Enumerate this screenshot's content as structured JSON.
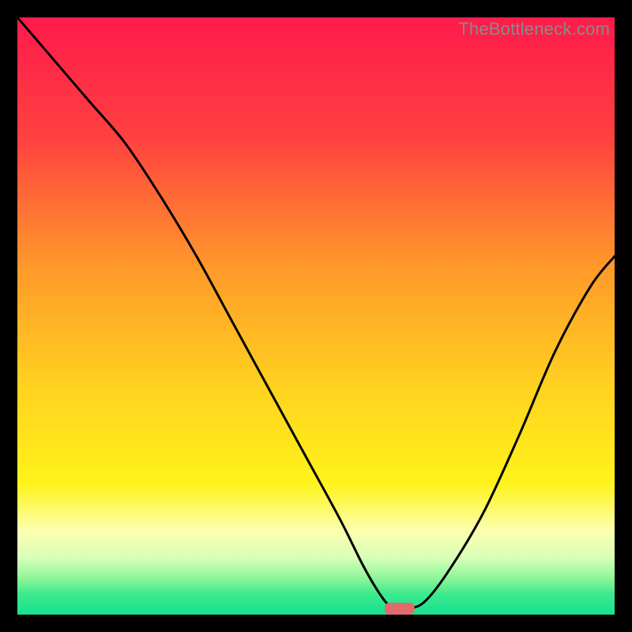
{
  "watermark": "TheBottleneck.com",
  "chart_data": {
    "type": "line",
    "title": "",
    "xlabel": "",
    "ylabel": "",
    "xlim": [
      0,
      100
    ],
    "ylim": [
      0,
      100
    ],
    "grid": false,
    "legend": false,
    "background_gradient_stops": [
      {
        "offset": 0.0,
        "color": "#ff1a4b"
      },
      {
        "offset": 0.2,
        "color": "#ff4040"
      },
      {
        "offset": 0.42,
        "color": "#ff9a2a"
      },
      {
        "offset": 0.62,
        "color": "#ffd21f"
      },
      {
        "offset": 0.78,
        "color": "#fff31a"
      },
      {
        "offset": 0.86,
        "color": "#fcffb0"
      },
      {
        "offset": 0.905,
        "color": "#d7ffb8"
      },
      {
        "offset": 0.94,
        "color": "#8cf598"
      },
      {
        "offset": 0.965,
        "color": "#3dea8d"
      },
      {
        "offset": 1.0,
        "color": "#16e18f"
      }
    ],
    "series": [
      {
        "name": "bottleneck-curve",
        "color": "#000000",
        "x": [
          0,
          6,
          12,
          18,
          24,
          30,
          36,
          42,
          48,
          54,
          58,
          61,
          63,
          65,
          68,
          72,
          78,
          84,
          90,
          96,
          100
        ],
        "values": [
          100,
          93,
          86,
          79,
          70,
          60,
          49,
          38,
          27,
          16,
          8,
          3,
          1,
          1,
          2,
          7,
          17,
          30,
          44,
          55,
          60
        ]
      }
    ],
    "marker": {
      "shape": "rounded-rect",
      "color": "#e26a6a",
      "x_center": 64,
      "y": 1,
      "width": 5,
      "height": 2
    }
  }
}
